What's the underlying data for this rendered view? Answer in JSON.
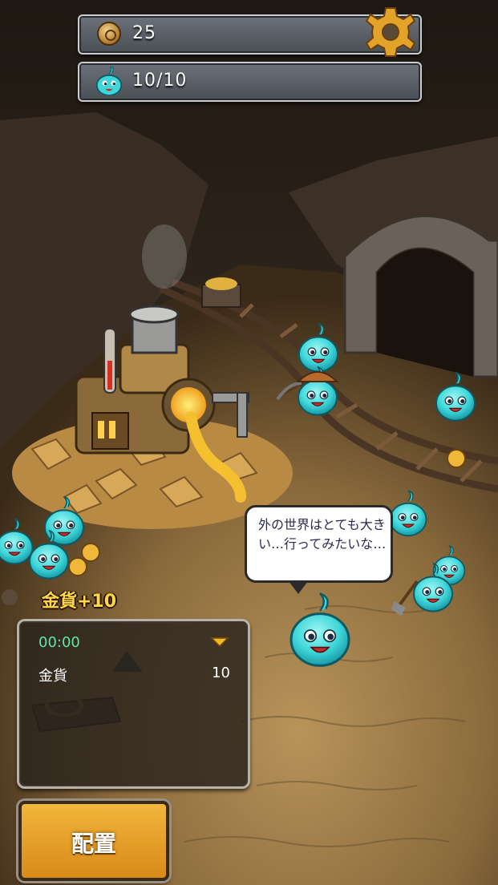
{
  "hud": {
    "coins": "25",
    "slimes": "10/10",
    "coin_icon": "gold-coin-icon",
    "slime_icon": "slime-icon",
    "settings_icon": "gear-icon"
  },
  "speech_bubble": {
    "text": "外の世界はとても大きい…行ってみたいな…"
  },
  "reward_popup": {
    "text": "金貨+10"
  },
  "production_panel": {
    "timer": "00:00",
    "resource_label": "金貨",
    "resource_value": "10"
  },
  "deploy_button": {
    "label": "配置"
  },
  "colors": {
    "slime": "#3fd6d9",
    "button": "#e9a52a",
    "timer": "#5ee6a8"
  }
}
